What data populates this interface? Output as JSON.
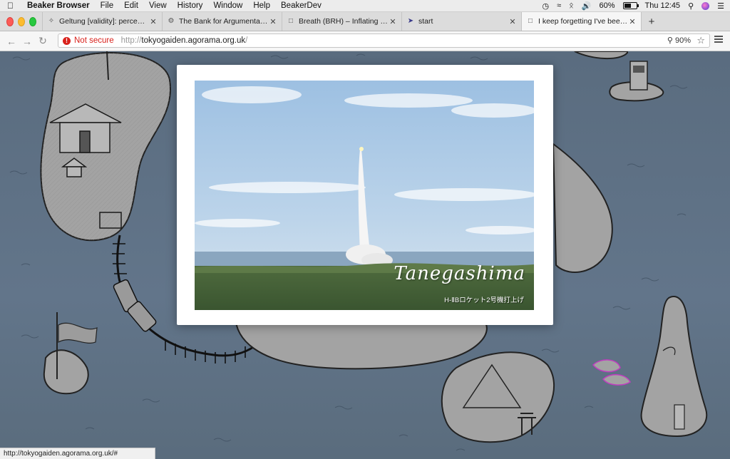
{
  "menubar": {
    "app": "Beaker Browser",
    "items": [
      "File",
      "Edit",
      "View",
      "History",
      "Window",
      "Help",
      "BeakerDev"
    ],
    "battery": "60%",
    "battery_level": 0.6,
    "clock": "Thu 12:45"
  },
  "tabs": [
    {
      "title": "Geltung [validity]: perception ...",
      "icon": "puzzle-icon"
    },
    {
      "title": "The Bank for Argumentation",
      "icon": "gear-icon"
    },
    {
      "title": "Breath (BRH) – Inflating Crypt...",
      "icon": "page-icon"
    },
    {
      "title": "start",
      "icon": "bird-icon"
    },
    {
      "title": "I keep forgetting I've been to ...",
      "icon": "page-icon",
      "active": true
    }
  ],
  "nav": {
    "not_secure": "Not secure",
    "url_protocol": "http://",
    "url_host": "tokyogaiden.agorama.org.uk",
    "url_path": "/",
    "zoom": "90%"
  },
  "photo": {
    "title": "Tanegashima",
    "subtitle": "H-ⅡBロケット2号機打上げ"
  },
  "status": {
    "url": "http://tokyogaiden.agorama.org.uk/#"
  },
  "colors": {
    "sea": "#5d6f80",
    "not_secure": "#d9221c",
    "island": "#a3a3a3"
  }
}
